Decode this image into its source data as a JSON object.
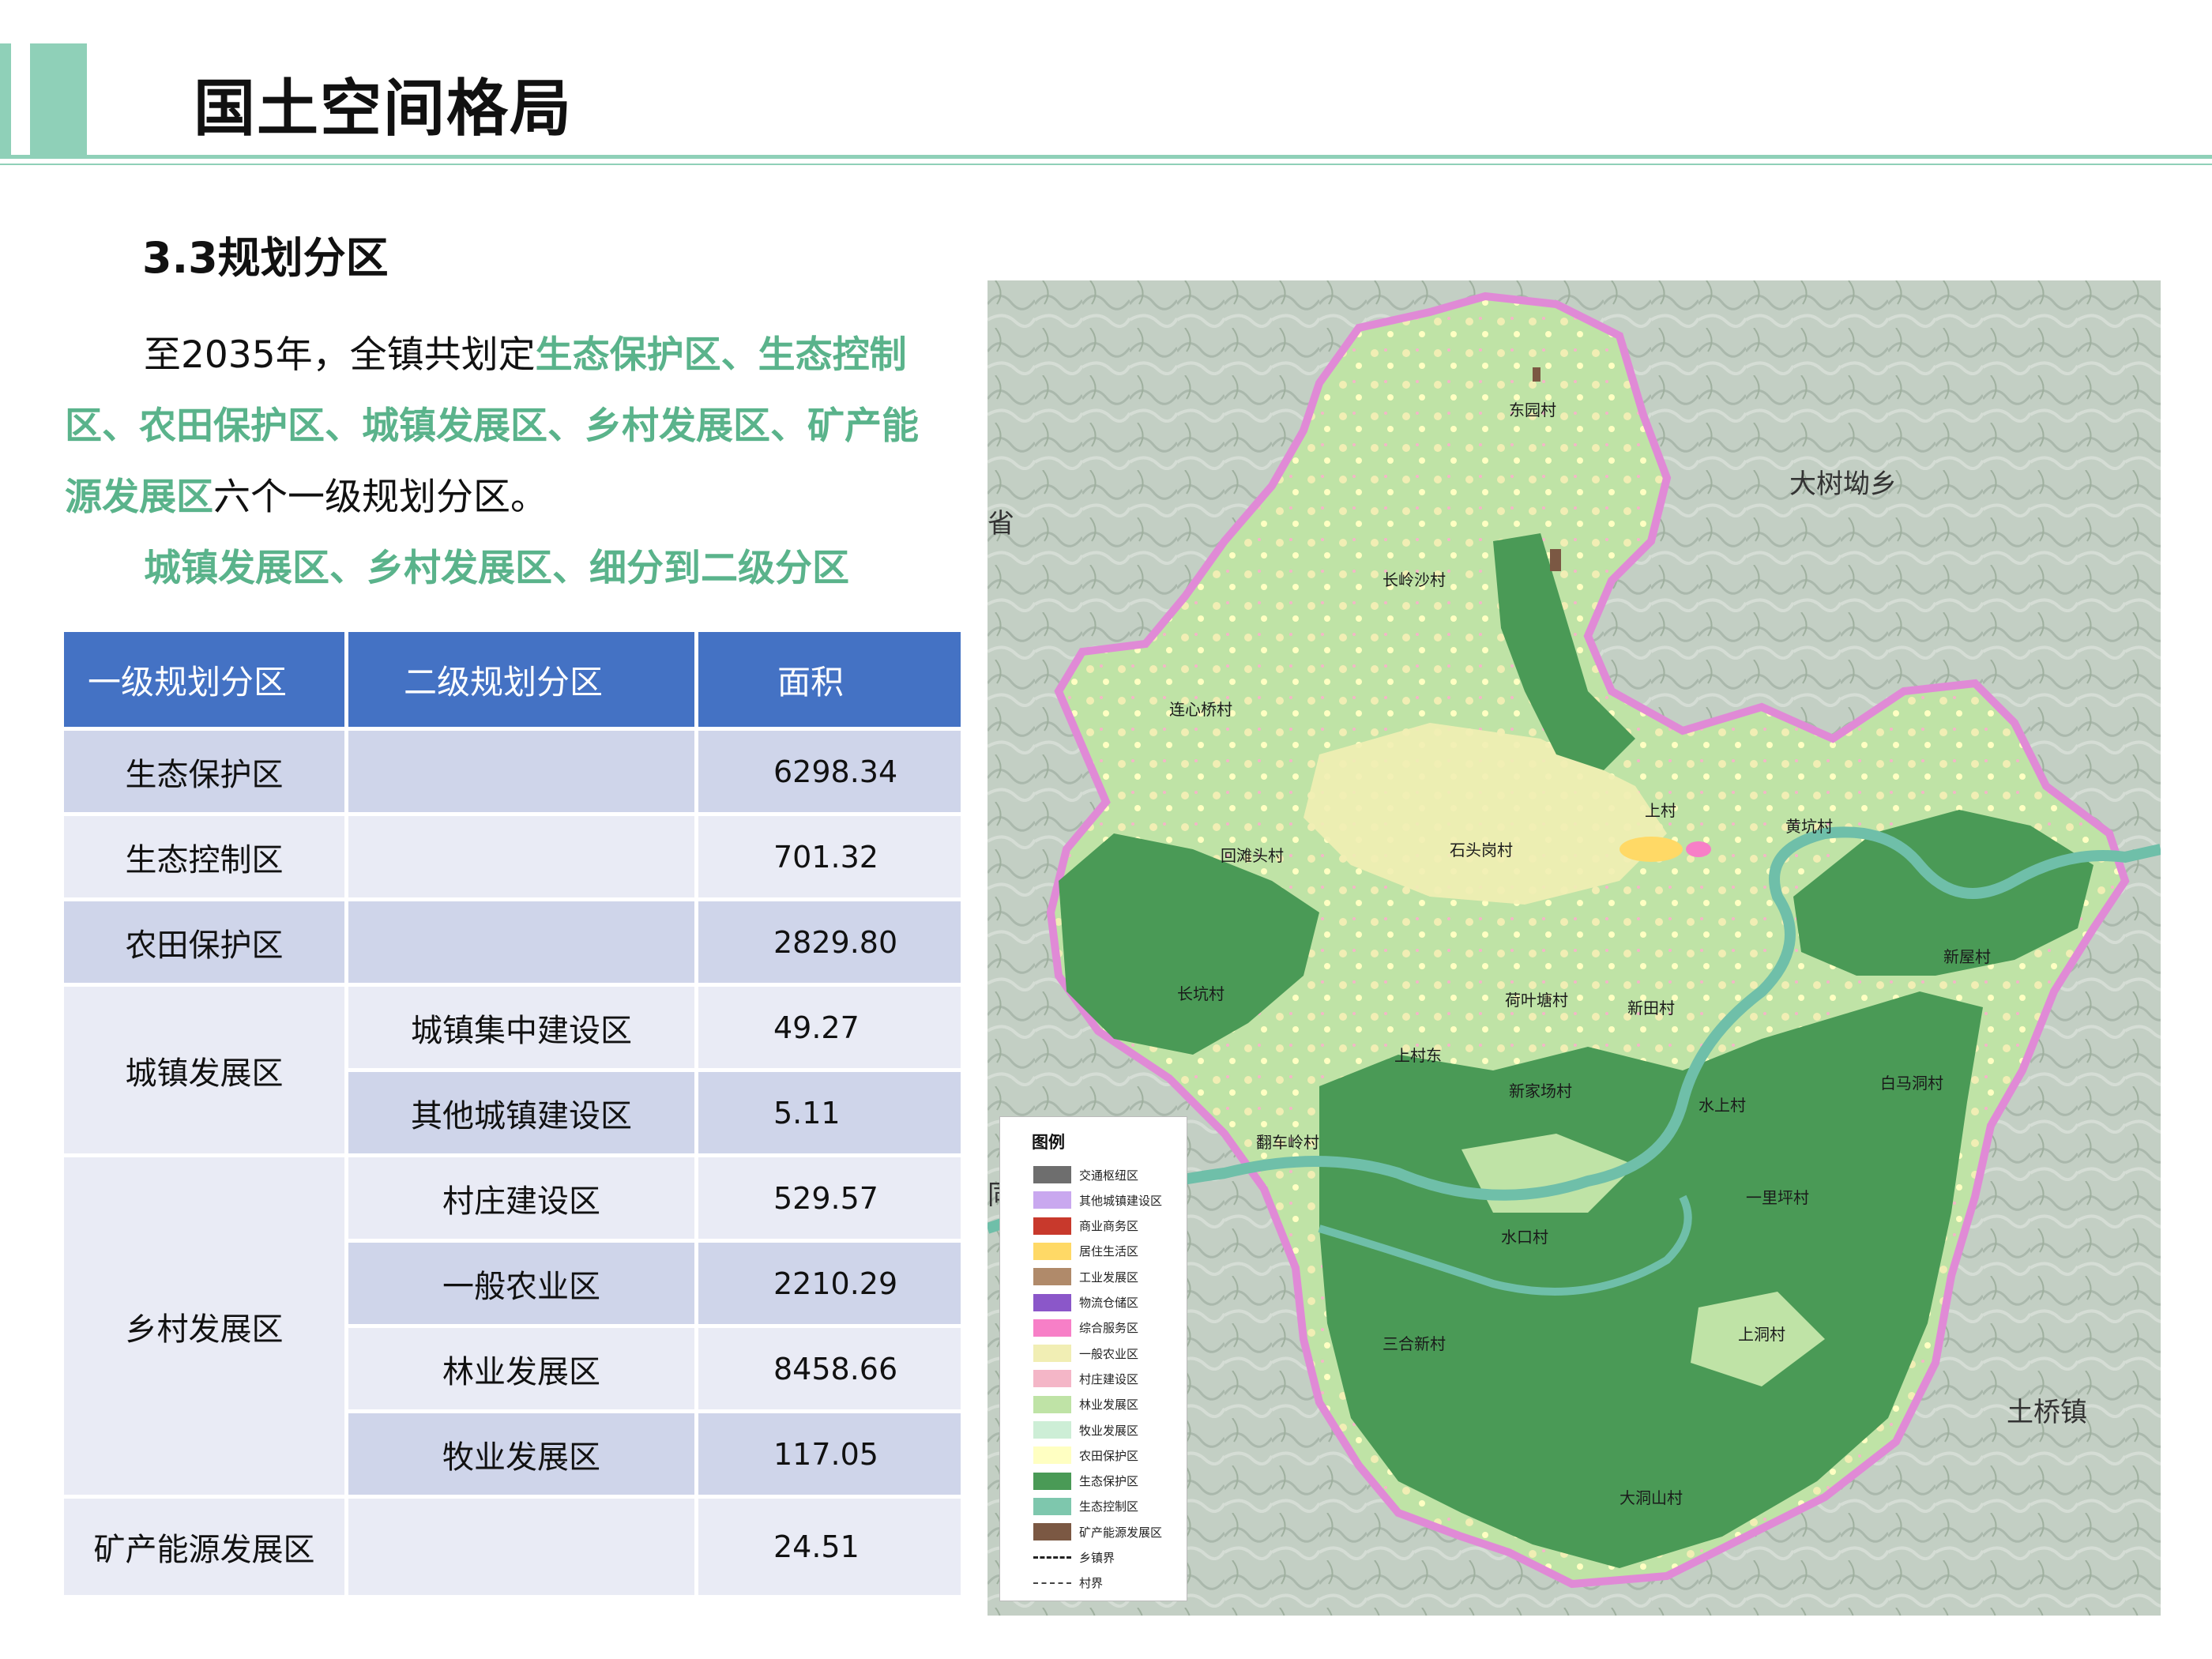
{
  "header": {
    "title": "国土空间格局"
  },
  "section": {
    "heading": "3.3规划分区"
  },
  "intro": {
    "p1_start": "至2035年，全镇共划定",
    "p1_hl1": "生态保护区、生态控制区、农田保护区、城镇发展区、乡村发展区、矿产能源发展区",
    "p1_end": "六个一级规划分区。",
    "p2_hl": "城镇发展区、乡村发展区、细分到二级分区"
  },
  "table": {
    "headers": [
      "一级规划分区",
      "二级规划分区",
      "面积"
    ],
    "rows": [
      {
        "level1": "生态保护区",
        "level2": "",
        "area": "6298.34"
      },
      {
        "level1": "生态控制区",
        "level2": "",
        "area": "701.32"
      },
      {
        "level1": "农田保护区",
        "level2": "",
        "area": "2829.80"
      },
      {
        "level1": "城镇发展区",
        "level2": "城镇集中建设区",
        "area": "49.27"
      },
      {
        "level1": "",
        "level2": "其他城镇建设区",
        "area": "5.11"
      },
      {
        "level1": "乡村发展区",
        "level2": "村庄建设区",
        "area": "529.57"
      },
      {
        "level1": "",
        "level2": "一般农业区",
        "area": "2210.29"
      },
      {
        "level1": "",
        "level2": "林业发展区",
        "area": "8458.66"
      },
      {
        "level1": "",
        "level2": "牧业发展区",
        "area": "117.05"
      },
      {
        "level1": "矿产能源发展区",
        "level2": "",
        "area": "24.51"
      }
    ]
  },
  "map": {
    "region_labels": [
      "大树坳乡",
      "土桥镇",
      "省",
      "同"
    ],
    "village_labels": [
      "东园村",
      "长岭沙村",
      "连心桥村",
      "回滩头村",
      "长坑村",
      "上村",
      "黄坑村",
      "石头岗村",
      "荷叶塘村",
      "新田村",
      "上村东",
      "新家场村",
      "水上村",
      "新屋村",
      "白马洞村",
      "一里坪村",
      "水口村",
      "上洞村",
      "三合新村",
      "翻车岭村",
      "大洞山村"
    ],
    "legend_title": "图例",
    "legend": [
      {
        "label": "交通枢纽区",
        "color": "#6e6e6e"
      },
      {
        "label": "其他城镇建设区",
        "color": "#c9a8ef"
      },
      {
        "label": "商业商务区",
        "color": "#c8392c"
      },
      {
        "label": "居住生活区",
        "color": "#ffd966"
      },
      {
        "label": "工业发展区",
        "color": "#b08a6a"
      },
      {
        "label": "物流仓储区",
        "color": "#8b57c9"
      },
      {
        "label": "综合服务区",
        "color": "#f77fc7"
      },
      {
        "label": "一般农业区",
        "color": "#f1eeb4"
      },
      {
        "label": "村庄建设区",
        "color": "#f4b6c7"
      },
      {
        "label": "林业发展区",
        "color": "#bfe3a6"
      },
      {
        "label": "牧业发展区",
        "color": "#cdeed6"
      },
      {
        "label": "农田保护区",
        "color": "#ffffc2"
      },
      {
        "label": "生态保护区",
        "color": "#4a9a56"
      },
      {
        "label": "生态控制区",
        "color": "#7ec7ad"
      },
      {
        "label": "矿产能源发展区",
        "color": "#7b5843"
      }
    ],
    "legend_lines": [
      {
        "label": "乡镇界"
      },
      {
        "label": "村界"
      }
    ]
  }
}
